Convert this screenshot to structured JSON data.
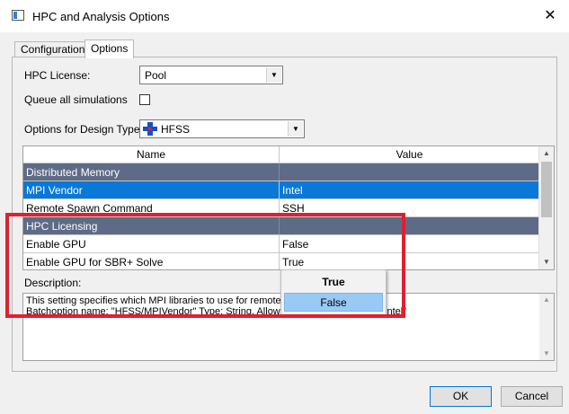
{
  "window": {
    "title": "HPC and Analysis Options",
    "close_glyph": "✕"
  },
  "tabs": [
    {
      "label": "Configurations"
    },
    {
      "label": "Options"
    }
  ],
  "form": {
    "hpc_license": {
      "label": "HPC License:",
      "value": "Pool"
    },
    "queue_all": {
      "label": "Queue all simulations",
      "checked": false
    },
    "design_type": {
      "label": "Options for Design Type:",
      "value": "HFSS",
      "icon": "hfss-icon"
    }
  },
  "grid": {
    "columns": [
      "Name",
      "Value"
    ],
    "rows": [
      {
        "name": "Distributed Memory",
        "value": "",
        "kind": "group"
      },
      {
        "name": "MPI Vendor",
        "value": "Intel",
        "kind": "selected"
      },
      {
        "name": "Remote Spawn Command",
        "value": "SSH",
        "kind": "normal"
      },
      {
        "name": "HPC Licensing",
        "value": "",
        "kind": "group"
      },
      {
        "name": "Enable GPU",
        "value": "False",
        "kind": "normal"
      },
      {
        "name": "Enable GPU for SBR+ Solve",
        "value": "True",
        "kind": "normal"
      }
    ]
  },
  "dropdown": {
    "options": [
      "True",
      "False"
    ],
    "highlighted": "False"
  },
  "description": {
    "label": "Description:",
    "line1": "This setting specifies which MPI libraries to use for remote co",
    "line2": "Batchoption name: \"HFSS/MPIVendor\" Type: String, Allowed values: \"Microsoft\", \"Intel\""
  },
  "buttons": {
    "ok": "OK",
    "cancel": "Cancel"
  },
  "colors": {
    "group_row": "#5d6b86",
    "selected_row": "#0a78d7",
    "highlight_box": "#e0202e",
    "dropdown_hover": "#99c9f5"
  }
}
